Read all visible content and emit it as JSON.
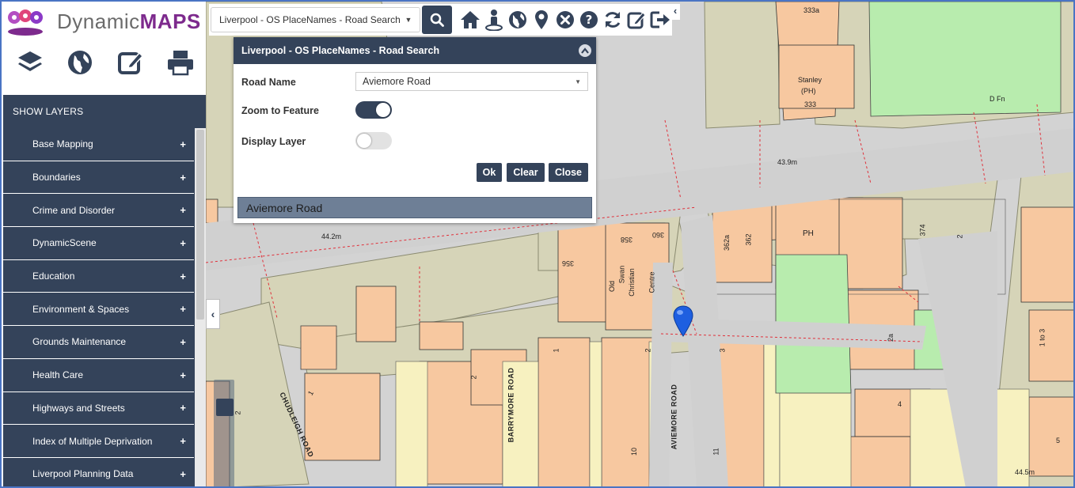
{
  "app": {
    "brand_plain": "Dynamic",
    "brand_bold": "MAPS",
    "colors": {
      "primary": "#34435a",
      "brand_purple": "#7d2a8d",
      "building": "#f5c9a0",
      "green": "#b8ecae",
      "pin": "#1e5fe0"
    }
  },
  "toolbar_icons": [
    "layers-icon",
    "globe-icon",
    "edit-icon",
    "print-icon"
  ],
  "sidebar": {
    "header": "SHOW LAYERS",
    "items": [
      {
        "label": "Base Mapping"
      },
      {
        "label": "Boundaries"
      },
      {
        "label": "Crime and Disorder"
      },
      {
        "label": "DynamicScene"
      },
      {
        "label": "Education"
      },
      {
        "label": "Environment & Spaces"
      },
      {
        "label": "Grounds Maintenance"
      },
      {
        "label": "Health Care"
      },
      {
        "label": "Highways and Streets"
      },
      {
        "label": "Index of Multiple Deprivation"
      },
      {
        "label": "Liverpool Planning Data"
      }
    ],
    "plus": "+"
  },
  "search": {
    "selected": "Liverpool - OS PlaceNames - Road Search",
    "top_icons": [
      "home-icon",
      "person-pin-icon",
      "globe-icon",
      "map-marker-icon",
      "close-circle-icon",
      "help-icon",
      "refresh-icon",
      "edit-icon",
      "sign-out-icon"
    ]
  },
  "panel": {
    "title": "Liverpool - OS PlaceNames - Road Search",
    "road_name_label": "Road Name",
    "road_name_value": "Aviemore Road",
    "zoom_label": "Zoom to Feature",
    "zoom_on": true,
    "display_label": "Display Layer",
    "display_on": false,
    "ok": "Ok",
    "clear": "Clear",
    "close": "Close",
    "result": "Aviemore Road"
  },
  "map": {
    "labels": {
      "l333a": "333a",
      "stanley": "Stanley",
      "ph": "(PH)",
      "l333": "333",
      "dfn": "D Fn",
      "l439": "43.9m",
      "l442": "44.2m",
      "l445": "44.5m",
      "ph2": "PH",
      "l362a": "362a",
      "l362": "362",
      "l374": "374",
      "l2": "2",
      "l360": "360",
      "l358": "358",
      "l356": "356",
      "old": "Old",
      "swan": "Swan",
      "christian": "Christian",
      "centre": "Centre",
      "l2a": "2a",
      "l1to3": "1 to 3",
      "l4": "4",
      "l5": "5",
      "l1a": "1",
      "l2b": "2",
      "l1b": "1",
      "l2c": "2",
      "l3": "3",
      "l10": "10",
      "l11": "11",
      "l2d": "2"
    },
    "roads": {
      "chudleigh": "CHUDLEIGH ROAD",
      "barrymore": "BARRYMORE ROAD",
      "aviemore": "AVIEMORE ROAD"
    }
  }
}
